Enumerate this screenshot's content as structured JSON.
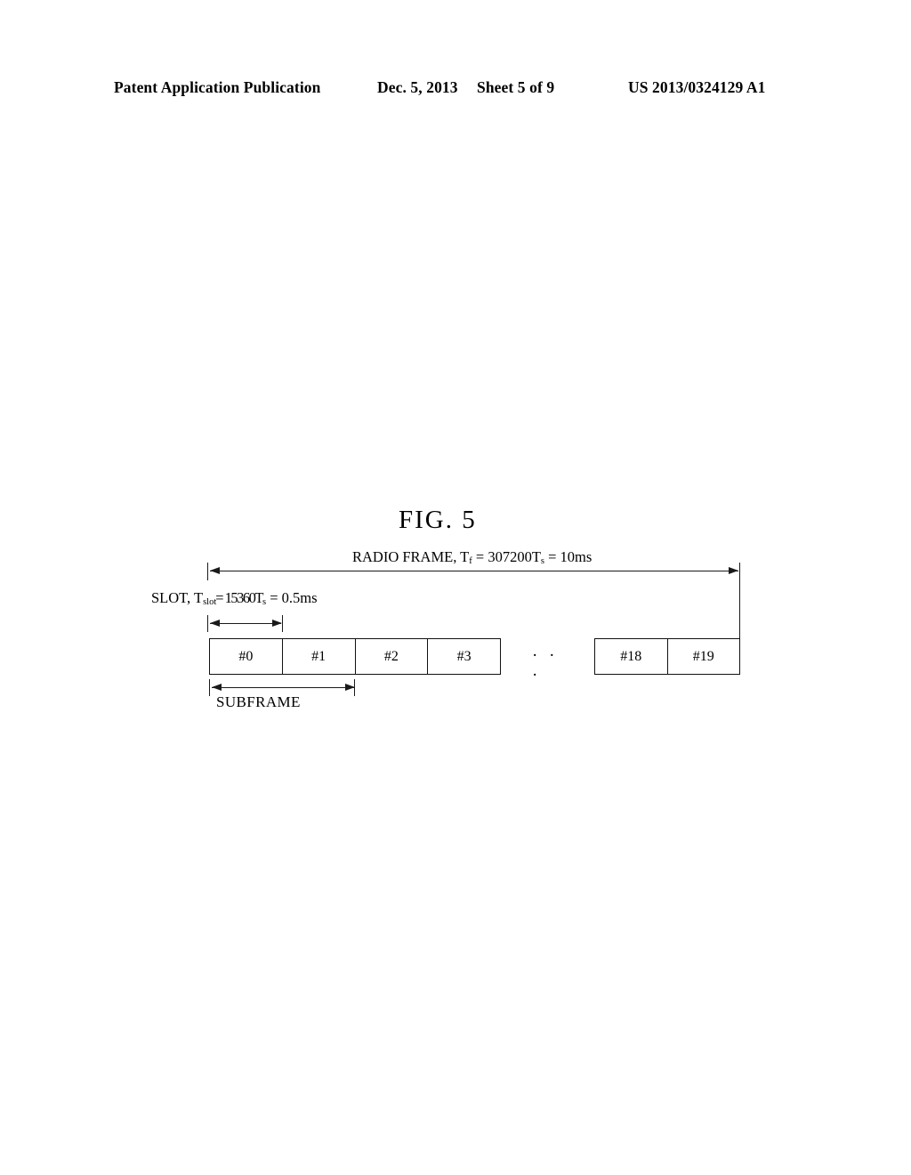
{
  "header": {
    "publication": "Patent Application Publication",
    "date": "Dec. 5, 2013",
    "sheet": "Sheet 5 of 9",
    "document_number": "US 2013/0324129 A1"
  },
  "figure": {
    "title": "FIG. 5",
    "radio_frame_label": {
      "prefix": "RADIO FRAME, T",
      "sub1": "f",
      "mid": " = 307200T",
      "sub2": "s",
      "suffix": " = 10ms",
      "full_text": "RADIO FRAME, Tf = 307200Ts = 10ms"
    },
    "slot_label": {
      "prefix": "SLOT, T",
      "sub1": "slot",
      "mid": " = 15360T",
      "sub2": "s",
      "suffix": " = 0.5ms",
      "full_text": "SLOT, Tslot = 15360Ts = 0.5ms"
    },
    "subframe_label": "SUBFRAME",
    "ellipsis": "· · ·",
    "subframe_boxes_left": [
      "#0",
      "#1",
      "#2",
      "#3"
    ],
    "subframe_boxes_right": [
      "#18",
      "#19"
    ],
    "colors": {
      "line": "#1a1a1a",
      "box_border": "#111111",
      "background": "#ffffff",
      "text": "#000000"
    }
  }
}
